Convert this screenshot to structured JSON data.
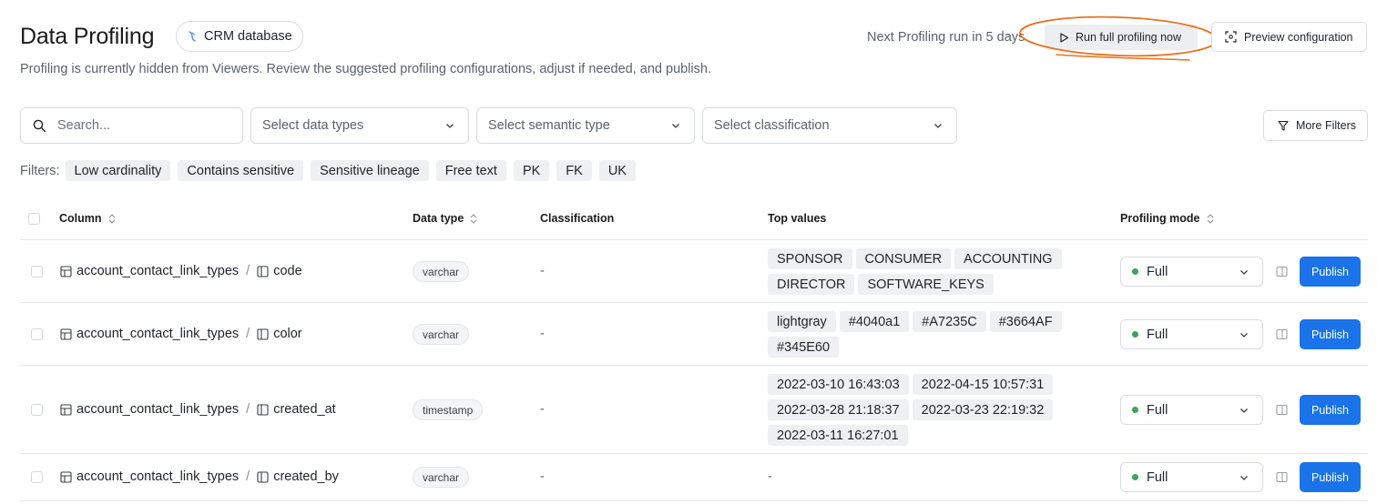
{
  "header": {
    "title": "Data Profiling",
    "database": "CRM database",
    "subtitle": "Profiling is currently hidden from Viewers. Review the suggested profiling configurations, adjust if needed, and publish.",
    "next_run": "Next Profiling run in 5 days",
    "run_button": "Run full profiling now",
    "preview_button": "Preview configuration",
    "annotation_color": "#e8731e"
  },
  "toolbar": {
    "search_placeholder": "Search...",
    "data_types_placeholder": "Select data types",
    "semantic_type_placeholder": "Select semantic type",
    "classification_placeholder": "Select classification",
    "more_filters": "More Filters"
  },
  "filters": {
    "label": "Filters:",
    "tags": [
      "Low cardinality",
      "Contains sensitive",
      "Sensitive lineage",
      "Free text",
      "PK",
      "FK",
      "UK"
    ]
  },
  "table": {
    "columns": {
      "column": "Column",
      "data_type": "Data type",
      "classification": "Classification",
      "top_values": "Top values",
      "profiling_mode": "Profiling mode"
    },
    "rows": [
      {
        "table": "account_contact_link_types",
        "separator": "/",
        "column": "code",
        "data_type": "varchar",
        "classification": "-",
        "top_values": [
          "SPONSOR",
          "CONSUMER",
          "ACCOUNTING",
          "DIRECTOR",
          "SOFTWARE_KEYS"
        ],
        "mode": "Full",
        "publish": "Publish"
      },
      {
        "table": "account_contact_link_types",
        "separator": "/",
        "column": "color",
        "data_type": "varchar",
        "classification": "-",
        "top_values": [
          "lightgray",
          "#4040a1",
          "#A7235C",
          "#3664AF",
          "#345E60"
        ],
        "mode": "Full",
        "publish": "Publish"
      },
      {
        "table": "account_contact_link_types",
        "separator": "/",
        "column": "created_at",
        "data_type": "timestamp",
        "classification": "-",
        "top_values": [
          "2022-03-10 16:43:03",
          "2022-04-15 10:57:31",
          "2022-03-28 21:18:37",
          "2022-03-23 22:19:32",
          "2022-03-11 16:27:01"
        ],
        "mode": "Full",
        "publish": "Publish"
      },
      {
        "table": "account_contact_link_types",
        "separator": "/",
        "column": "created_by",
        "data_type": "varchar",
        "classification": "-",
        "top_values_empty": "-",
        "mode": "Full",
        "publish": "Publish"
      }
    ]
  },
  "colors": {
    "primary": "#1a73e8",
    "status_full": "#3aa655"
  }
}
